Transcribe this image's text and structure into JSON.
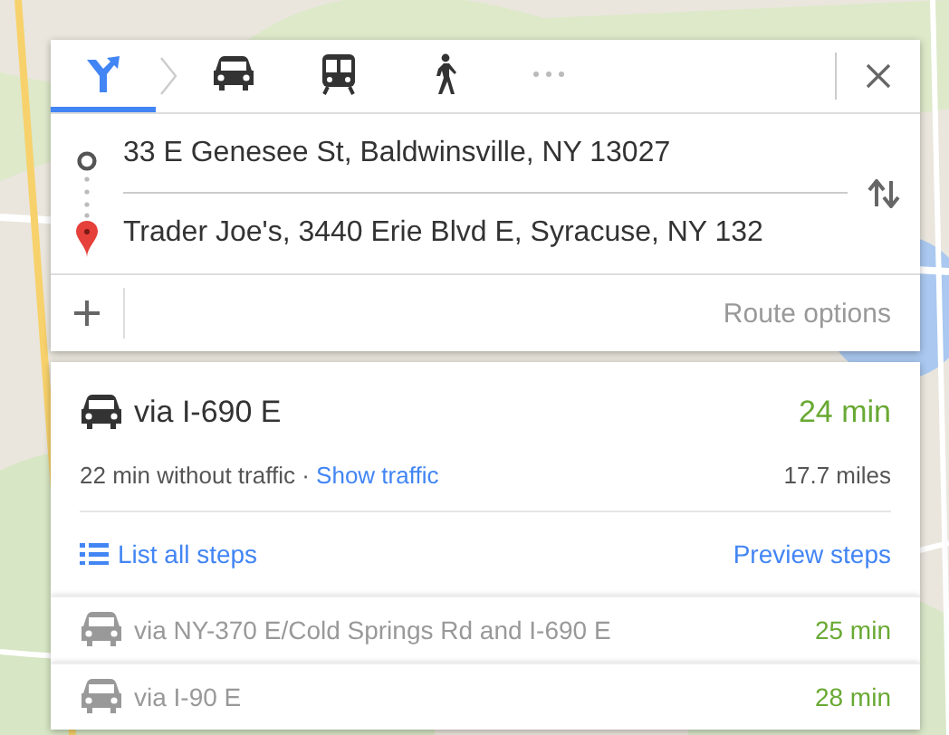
{
  "modes": [
    {
      "kind": "best",
      "selected": true
    },
    {
      "kind": "car",
      "selected": false
    },
    {
      "kind": "transit",
      "selected": false
    },
    {
      "kind": "walk",
      "selected": false
    },
    {
      "kind": "more",
      "selected": false
    }
  ],
  "origin": {
    "value": "33 E Genesee St, Baldwinsville, NY 13027"
  },
  "destination": {
    "value": "Trader Joe's, 3440 Erie Blvd E, Syracuse, NY 132"
  },
  "route_options": "Route options",
  "routes": [
    {
      "via": "via I-690 E",
      "time": "24 min",
      "selected": true,
      "detail": "22 min without traffic · ",
      "traffic_link": "Show traffic",
      "distance": "17.7 miles",
      "list_steps": "List all steps",
      "preview_steps": "Preview steps"
    },
    {
      "via": "via NY-370 E/Cold Springs Rd and I-690 E",
      "time": "25 min",
      "selected": false
    },
    {
      "via": "via I-90 E",
      "time": "28 min",
      "selected": false
    }
  ]
}
